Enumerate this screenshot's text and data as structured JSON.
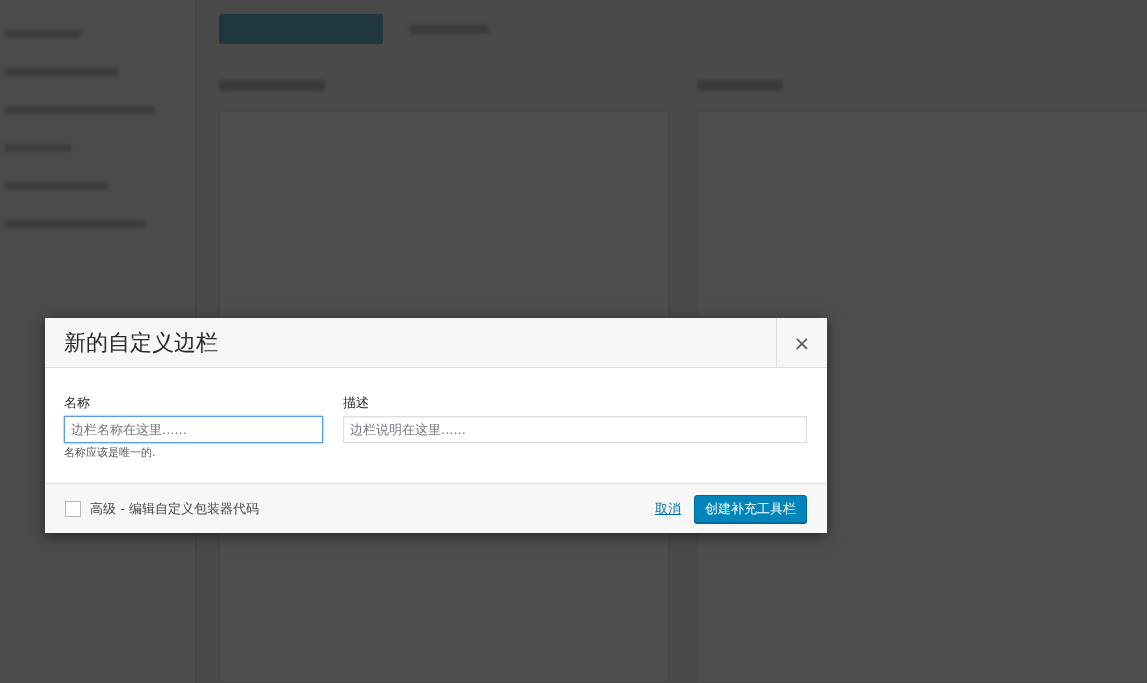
{
  "dialog": {
    "title": "新的自定义边栏",
    "close": "×",
    "fields": [
      {
        "label": "名称",
        "placeholder": "边栏名称在这里......",
        "focused": true,
        "hint": "名称应该是唯一的."
      },
      {
        "label": "描述",
        "placeholder": "边栏说明在这里......",
        "focused": false
      }
    ],
    "advanced": {
      "label": "高级 - 编辑自定义包装器代码",
      "checked": false
    },
    "cancel": "取消",
    "submit": "创建补充工具栏"
  }
}
